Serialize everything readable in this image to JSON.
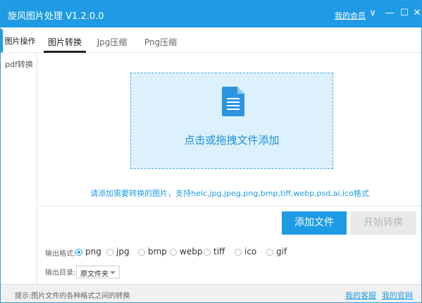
{
  "titlebar": {
    "title": "旋风图片处理 V1.2.0.0",
    "member_link": "我的会员",
    "dropdown_icon": "∨",
    "minimize_icon": "—",
    "maximize_icon": "☐",
    "close_icon": "✕"
  },
  "sidebar": {
    "items": [
      {
        "label": "图片操作"
      },
      {
        "label": "pdf转换"
      }
    ]
  },
  "tabs": [
    {
      "label": "图片转换"
    },
    {
      "label": "Jpg压缩"
    },
    {
      "label": "Png压缩"
    }
  ],
  "dropzone": {
    "text": "点击或拖拽文件添加",
    "icon": "document-icon"
  },
  "hint": "请添加需要转换的图片，支持heic,jpg,jpeg,png,bmp,tiff,webp,psd,ai,ico格式",
  "buttons": {
    "add_file": "添加文件",
    "start_convert": "开始转换"
  },
  "format": {
    "label": "输出格式:",
    "options": [
      "png",
      "jpg",
      "bmp",
      "webp",
      "tiff",
      "ico",
      "gif"
    ],
    "selected": "png"
  },
  "output_dir": {
    "label": "输出目录:",
    "value": "原文件夹"
  },
  "statusbar": {
    "text": "提示:图片文件的各种格式之间的转换",
    "link1": "我的客服",
    "link2": "我的官网"
  },
  "colors": {
    "accent": "#1e9be4",
    "dropzone_bg": "#dcf1fb",
    "disabled_button": "#e9e9e9"
  }
}
